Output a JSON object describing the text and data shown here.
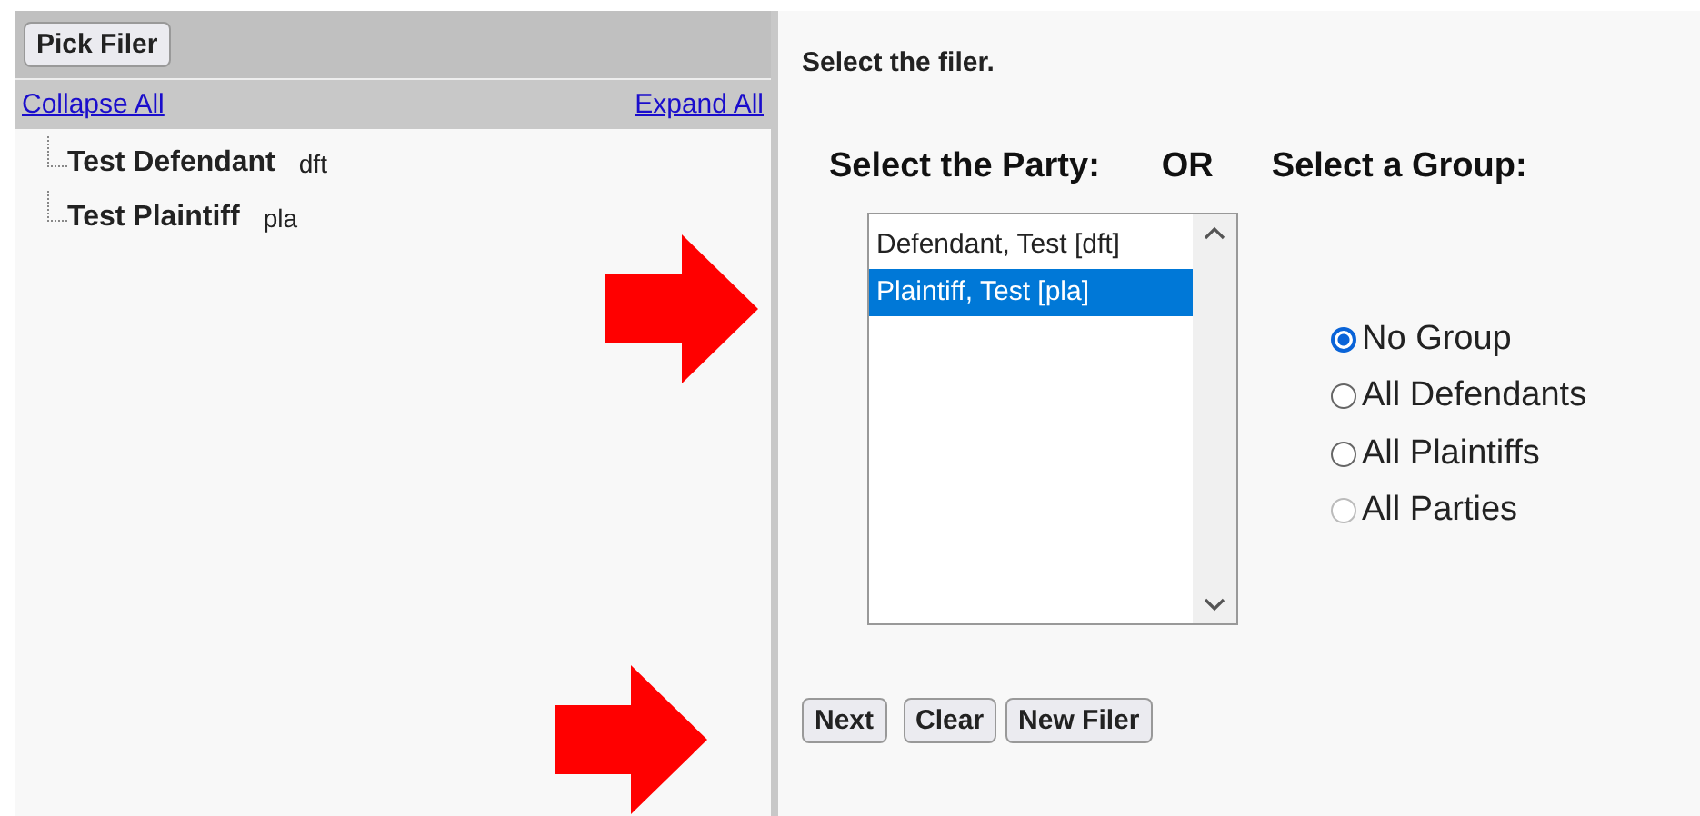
{
  "toolbar": {
    "button": "Pick Filer"
  },
  "tree_links": {
    "collapse": "Collapse All",
    "expand": "Expand All"
  },
  "tree": [
    {
      "name": "Test Defendant",
      "code": "dft"
    },
    {
      "name": "Test Plaintiff",
      "code": "pla"
    }
  ],
  "instruction": "Select the filer.",
  "party_heading": "Select the Party:",
  "or_label": "OR",
  "group_heading": "Select a Group:",
  "party_list": [
    {
      "label": "Defendant, Test [dft]",
      "selected": false
    },
    {
      "label": "Plaintiff, Test [pla]",
      "selected": true
    }
  ],
  "groups": [
    {
      "label": "No Group",
      "selected": true,
      "disabled": false
    },
    {
      "label": "All Defendants",
      "selected": false,
      "disabled": false
    },
    {
      "label": "All Plaintiffs",
      "selected": false,
      "disabled": false
    },
    {
      "label": "All Parties",
      "selected": false,
      "disabled": true
    }
  ],
  "buttons": [
    "Next",
    "Clear",
    "New Filer"
  ]
}
